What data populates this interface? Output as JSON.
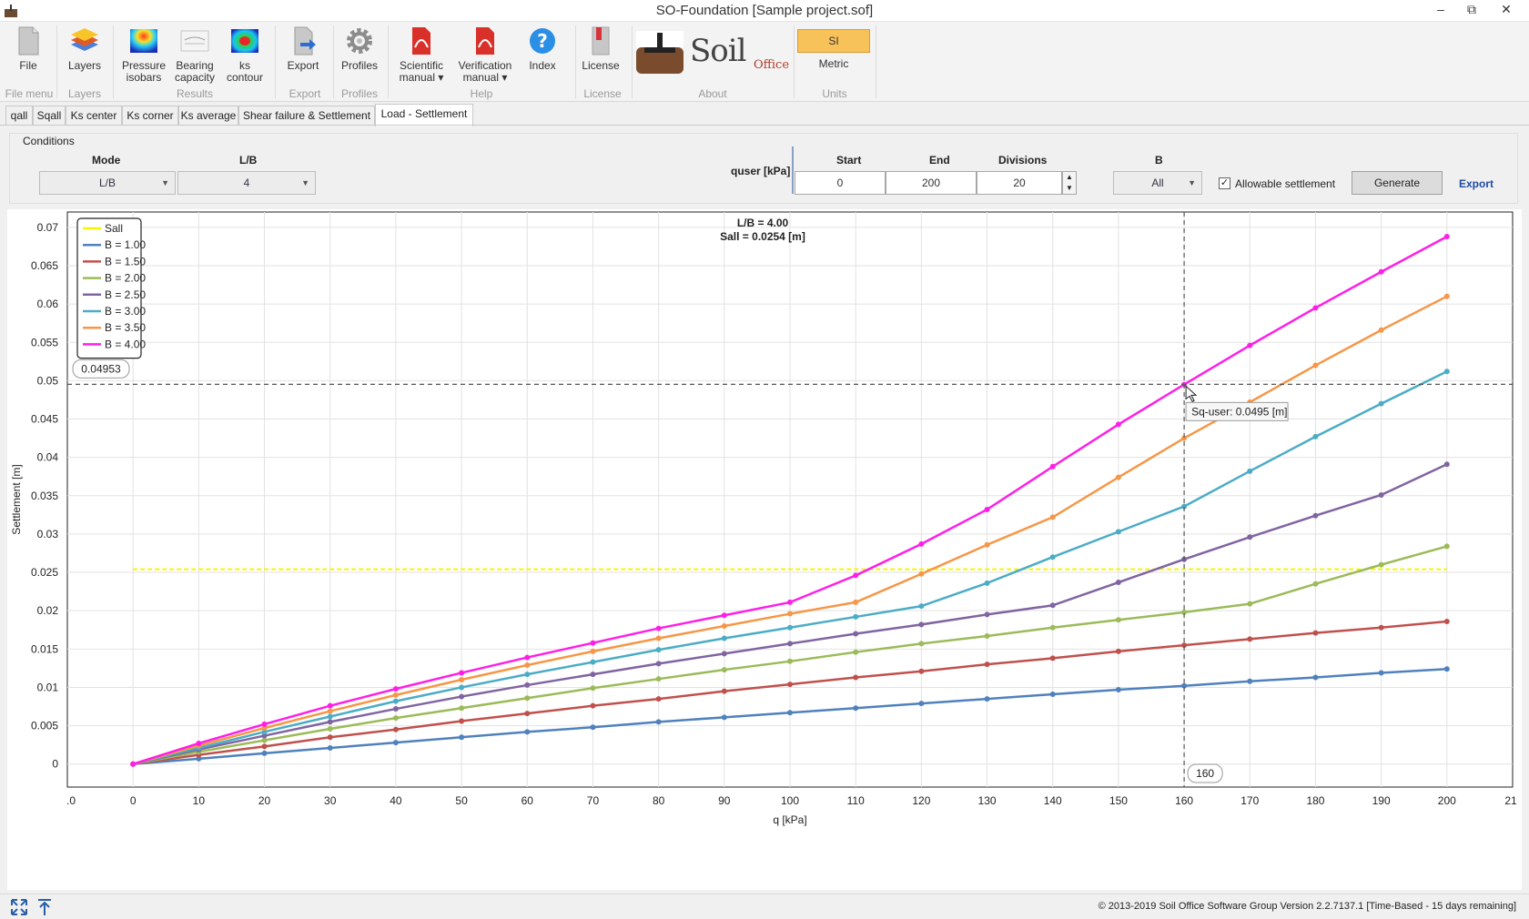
{
  "window": {
    "title": "SO-Foundation [Sample project.sof]"
  },
  "ribbon": {
    "buttons": [
      {
        "label": "File",
        "icon": "file-icon"
      },
      {
        "label": "Layers",
        "icon": "layers-icon"
      },
      {
        "label": "Pressure isobars",
        "icon": "pressure-isobars-icon"
      },
      {
        "label": "Bearing capacity",
        "icon": "bearing-capacity-icon"
      },
      {
        "label": "ks contour",
        "icon": "ks-contour-icon"
      },
      {
        "label": "Export",
        "icon": "export-icon"
      },
      {
        "label": "Profiles",
        "icon": "gear-icon"
      },
      {
        "label": "Scientific manual",
        "icon": "pdf-icon"
      },
      {
        "label": "Verification manual",
        "icon": "pdf-icon"
      },
      {
        "label": "Index",
        "icon": "help-icon"
      },
      {
        "label": "License",
        "icon": "license-icon"
      },
      {
        "label": "Metric",
        "icon": "units-icon"
      }
    ],
    "units_button": "SI",
    "groups": [
      "File menu",
      "Layers",
      "Results",
      "Export",
      "Profiles",
      "Help",
      "License",
      "About",
      "Units"
    ],
    "logo": "Soil",
    "logo_sub": "Office"
  },
  "tabs": [
    "qall",
    "Sqall",
    "Ks center",
    "Ks corner",
    "Ks average",
    "Shear failure & Settlement",
    "Load - Settlement"
  ],
  "conditions": {
    "title": "Conditions",
    "mode_label": "Mode",
    "mode_value": "L/B",
    "lb_label": "L/B",
    "lb_value": "4",
    "quser_label": "quser [kPa]",
    "start_label": "Start",
    "start_value": "0",
    "end_label": "End",
    "end_value": "200",
    "divisions_label": "Divisions",
    "divisions_value": "20",
    "b_label": "B",
    "b_value": "All",
    "allowable_label": "Allowable settlement",
    "generate_label": "Generate",
    "export_label": "Export"
  },
  "chart_data": {
    "type": "line",
    "title": "L/B = 4.00",
    "subtitle": "Sall = 0.0254 [m]",
    "xlabel": "q [kPa]",
    "ylabel": "Settlement [m]",
    "xlim": [
      -10,
      210
    ],
    "ylim": [
      -0.003,
      0.072
    ],
    "x_ticks": [
      0,
      10,
      20,
      30,
      40,
      50,
      60,
      70,
      80,
      90,
      100,
      110,
      120,
      130,
      140,
      150,
      160,
      170,
      180,
      190,
      200
    ],
    "x_tick_labels": [
      "0",
      "10",
      "20",
      "30",
      "40",
      "50",
      "60",
      "70",
      "80",
      "90",
      "100",
      "110",
      "120",
      "130",
      "140",
      "150",
      "160",
      "170",
      "180",
      "190",
      "200"
    ],
    "x_edge_labels": [
      ".0",
      "21"
    ],
    "y_ticks": [
      0,
      0.005,
      0.01,
      0.015,
      0.02,
      0.025,
      0.03,
      0.035,
      0.04,
      0.045,
      0.05,
      0.055,
      0.06,
      0.065,
      0.07
    ],
    "y_tick_labels": [
      "0",
      "0.005",
      "0.01",
      "0.015",
      "0.02",
      "0.025",
      "0.03",
      "0.035",
      "0.04",
      "0.045",
      "0.05",
      "0.055",
      "0.06",
      "0.065",
      "0.07"
    ],
    "grid": true,
    "legend_position": "top-left",
    "x": [
      0,
      10,
      20,
      30,
      40,
      50,
      60,
      70,
      80,
      90,
      100,
      110,
      120,
      130,
      140,
      150,
      160,
      170,
      180,
      190,
      200
    ],
    "sall": {
      "name": "Sall",
      "value": 0.0254,
      "color": "#f5f500"
    },
    "series": [
      {
        "name": "B = 1.00",
        "color": "#4f81bd",
        "values": [
          0,
          0.0007,
          0.0014,
          0.0021,
          0.0028,
          0.0035,
          0.0042,
          0.0048,
          0.0055,
          0.0061,
          0.0067,
          0.0073,
          0.0079,
          0.0085,
          0.0091,
          0.0097,
          0.0102,
          0.0108,
          0.0113,
          0.0119,
          0.0124
        ]
      },
      {
        "name": "B = 1.50",
        "color": "#c0504d",
        "values": [
          0,
          0.0012,
          0.0023,
          0.0035,
          0.0045,
          0.0056,
          0.0066,
          0.0076,
          0.0085,
          0.0095,
          0.0104,
          0.0113,
          0.0121,
          0.013,
          0.0138,
          0.0147,
          0.0155,
          0.0163,
          0.0171,
          0.0178,
          0.0186
        ]
      },
      {
        "name": "B = 2.00",
        "color": "#9bbb59",
        "values": [
          0,
          0.0016,
          0.0031,
          0.0046,
          0.006,
          0.0073,
          0.0086,
          0.0099,
          0.0111,
          0.0123,
          0.0134,
          0.0146,
          0.0157,
          0.0167,
          0.0178,
          0.0188,
          0.0198,
          0.0209,
          0.0235,
          0.026,
          0.0284
        ]
      },
      {
        "name": "B = 2.50",
        "color": "#8064a2",
        "values": [
          0,
          0.0019,
          0.0037,
          0.0055,
          0.0072,
          0.0088,
          0.0103,
          0.0117,
          0.0131,
          0.0144,
          0.0157,
          0.017,
          0.0182,
          0.0195,
          0.0207,
          0.0237,
          0.0267,
          0.0296,
          0.0324,
          0.0351,
          0.0391
        ]
      },
      {
        "name": "B = 3.00",
        "color": "#4bacc6",
        "values": [
          0,
          0.0021,
          0.0042,
          0.0062,
          0.0082,
          0.01,
          0.0117,
          0.0133,
          0.0149,
          0.0164,
          0.0178,
          0.0192,
          0.0206,
          0.0236,
          0.027,
          0.0303,
          0.0336,
          0.0382,
          0.0427,
          0.047,
          0.0512
        ]
      },
      {
        "name": "B = 3.50",
        "color": "#f79646",
        "values": [
          0,
          0.0024,
          0.0047,
          0.0069,
          0.009,
          0.011,
          0.0129,
          0.0147,
          0.0164,
          0.018,
          0.0196,
          0.0211,
          0.0248,
          0.0286,
          0.0322,
          0.0374,
          0.0425,
          0.0472,
          0.052,
          0.0566,
          0.061
        ]
      },
      {
        "name": "B = 4.00",
        "color": "#ff1ee8",
        "values": [
          0,
          0.0027,
          0.0052,
          0.0076,
          0.0098,
          0.0119,
          0.0139,
          0.0158,
          0.0177,
          0.0194,
          0.0211,
          0.0246,
          0.0287,
          0.0332,
          0.0388,
          0.0443,
          0.0495,
          0.0546,
          0.0595,
          0.0642,
          0.0688
        ]
      }
    ],
    "crosshair": {
      "x": 160,
      "y": 0.04953,
      "x_label": "160",
      "y_label": "0.04953"
    },
    "tooltip": "Sq-user: 0.0495 [m]"
  },
  "status": {
    "copyright": "© 2013-2019  Soil Office Software Group    Version 2.2.7137.1 [Time-Based - 15 days remaining]"
  }
}
